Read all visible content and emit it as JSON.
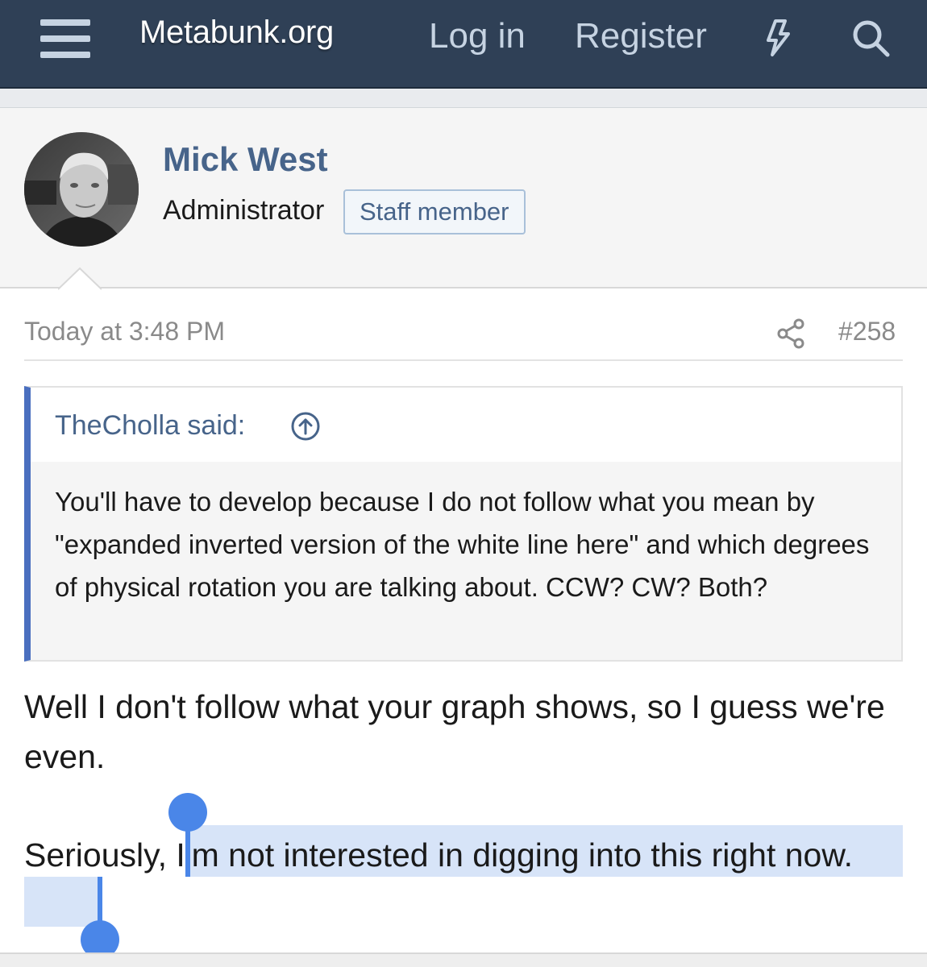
{
  "nav": {
    "logo": "Metabunk.org",
    "login": "Log in",
    "register": "Register",
    "icons": [
      "menu-icon",
      "bolt-icon",
      "search-icon"
    ]
  },
  "user": {
    "name": "Mick West",
    "title": "Administrator",
    "badge": "Staff member",
    "avatar": "user-photo"
  },
  "post": {
    "time": "Today at 3:48 PM",
    "number": "#258",
    "share_icon": "share-icon",
    "quote": {
      "author": "TheCholla said:",
      "jump_icon": "arrow-up-circle-icon",
      "text": "You'll have to develop because I do not follow what you mean by \"expanded inverted version of the white line here\" and which degrees of physical rotation you are talking about. CCW? CW? Both?"
    },
    "body": {
      "para1": "Well I don't follow what your graph shows, so I guess we're even.",
      "para2_lead": "Seriously, ",
      "para2_selected": "I'm not interested in digging into this right now."
    }
  },
  "colors": {
    "nav_bg": "#2f4056",
    "nav_text": "#c6d3e2",
    "link": "#47648a",
    "quote_accent": "#4a6fbf",
    "selection": "#d7e4f8",
    "handle": "#4a86e8"
  }
}
